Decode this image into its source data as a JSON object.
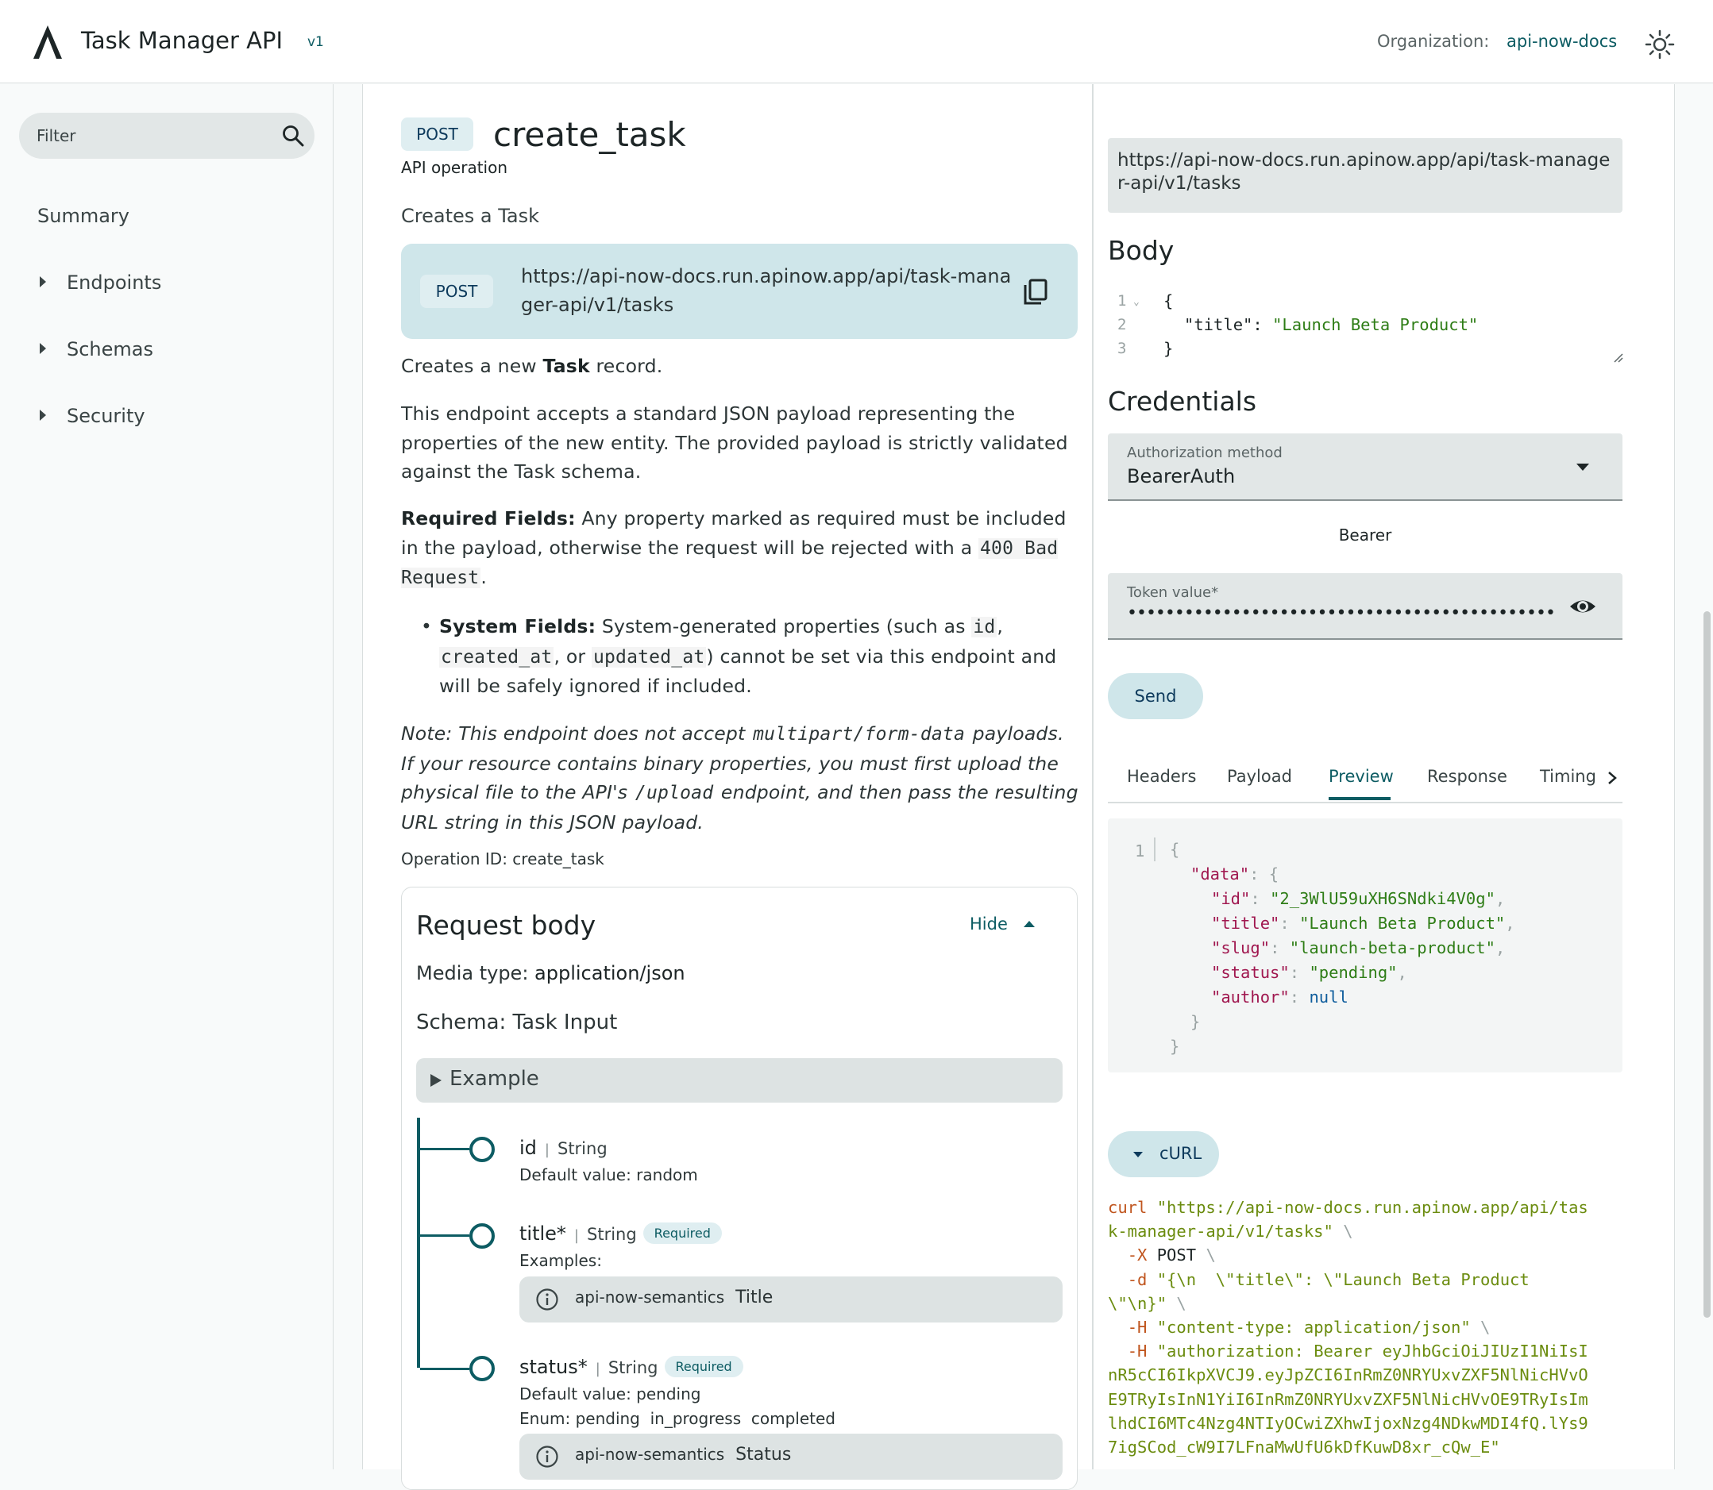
{
  "header": {
    "app_title": "Task Manager API",
    "version": "v1",
    "org_label": "Organization:",
    "org_value": "api-now-docs"
  },
  "sidebar": {
    "filter_placeholder": "Filter",
    "items": [
      {
        "label": "Summary",
        "expandable": false
      },
      {
        "label": "Endpoints",
        "expandable": true
      },
      {
        "label": "Schemas",
        "expandable": true
      },
      {
        "label": "Security",
        "expandable": true
      }
    ]
  },
  "operation": {
    "method": "POST",
    "name": "create_task",
    "subtitle": "API operation",
    "summary": "Creates a Task",
    "url": "https://api-now-docs.run.apinow.app/api/task-manager-api/v1/tasks",
    "desc_intro_prefix": "Creates a new ",
    "desc_intro_bold": "Task",
    "desc_intro_suffix": " record.",
    "desc_p1": "This endpoint accepts a standard JSON payload representing the properties of the new entity. The provided payload is strictly validated against the Task schema.",
    "desc_required_label": "Required Fields:",
    "desc_required_text": " Any property marked as required must be included in the payload, otherwise the request will be rejected with a ",
    "desc_required_code": "400 Bad Request",
    "desc_system_label": "System Fields:",
    "desc_system_text1": " System-generated properties (such as ",
    "desc_system_code1": "id",
    "desc_system_code2": "created_at",
    "desc_system_text2": ", or ",
    "desc_system_code3": "updated_at",
    "desc_system_text3": ") cannot be set via this endpoint and will be safely ignored if included.",
    "note_text1": "Note: This endpoint does not accept ",
    "note_code1": "multipart/form-data",
    "note_text2": " payloads. If your resource contains binary properties, you must first upload the physical file to the API's ",
    "note_code2": "/upload",
    "note_text3": " endpoint, and then pass the resulting URL string in this JSON payload.",
    "operation_id": "Operation ID: create_task"
  },
  "request_body": {
    "title": "Request body",
    "hide_label": "Hide",
    "media_label": "Media type: ",
    "media_value": "application/json",
    "schema": "Schema: Task Input",
    "example_label": "Example",
    "properties": [
      {
        "name": "id",
        "type": "String",
        "required": false,
        "meta": "Default value: random"
      },
      {
        "name": "title*",
        "type": "String",
        "required": true,
        "required_label": "Required",
        "meta": "Examples:",
        "semantic_prefix": "api-now-semantics",
        "semantic": "Title"
      },
      {
        "name": "status*",
        "type": "String",
        "required": true,
        "required_label": "Required",
        "meta": "Default value: pending",
        "enum": "Enum: pending  in_progress  completed",
        "semantic_prefix": "api-now-semantics",
        "semantic": "Status"
      }
    ]
  },
  "try_panel": {
    "url": "https://api-now-docs.run.apinow.app/api/task-manager-api/v1/tasks",
    "body_heading": "Body",
    "body_lines": [
      "{",
      "\"title\": \"Launch Beta Product\"",
      "}"
    ],
    "body_key": "\"title\"",
    "body_value": "\"Launch Beta Product\"",
    "credentials_heading": "Credentials",
    "auth_label": "Authorization method",
    "auth_value": "BearerAuth",
    "bearer_label": "Bearer",
    "token_label": "Token value*",
    "token_mask": "••••••••••••••••••••••••••••••••••••••••••••••••••••••••••••••••••",
    "send_label": "Send",
    "tabs": [
      "Headers",
      "Payload",
      "Preview",
      "Response",
      "Timing"
    ],
    "active_tab": "Preview",
    "preview": {
      "data_key": "\"data\"",
      "fields": [
        {
          "key": "\"id\"",
          "value": "\"2_3WlU59uXH6SNdki4V0g\""
        },
        {
          "key": "\"title\"",
          "value": "\"Launch Beta Product\""
        },
        {
          "key": "\"slug\"",
          "value": "\"launch-beta-product\""
        },
        {
          "key": "\"status\"",
          "value": "\"pending\""
        },
        {
          "key": "\"author\"",
          "value": "null"
        }
      ]
    },
    "curl_label": "cURL",
    "curl": {
      "cmd": "curl",
      "url_line1": "\"https://api-now-docs.run.apinow.app/api/tas",
      "url_line2": "k-manager-api/v1/tasks\"",
      "x_flag": "-X",
      "x_value": "POST",
      "d_flag": "-d",
      "d_line1": "\"{\\n  \\\"title\\\": \\\"Launch Beta Product",
      "d_line2": "\\\"\\n}\"",
      "h_flag": "-H",
      "h1_value": "\"content-type: application/json\"",
      "h2_line1": "\"authorization: Bearer eyJhbGciOiJIUzI1NiIsI",
      "h2_line2": "nR5cCI6IkpXVCJ9.eyJpZCI6InRmZ0NRYUxvZXF5NlNicHVvO",
      "h2_line3": "E9TRyIsInN1YiI6InRmZ0NRYUxvZXF5NlNicHVvOE9TRyIsIm",
      "h2_line4": "lhdCI6MTc4Nzg4NTIyOCwiZXhwIjoxNzg4NDkwMDI4fQ.lYs9",
      "h2_line5": "7igSCod_cW9I7LFnaMwUfU6kDfKuwD8xr_cQw_E\""
    }
  }
}
